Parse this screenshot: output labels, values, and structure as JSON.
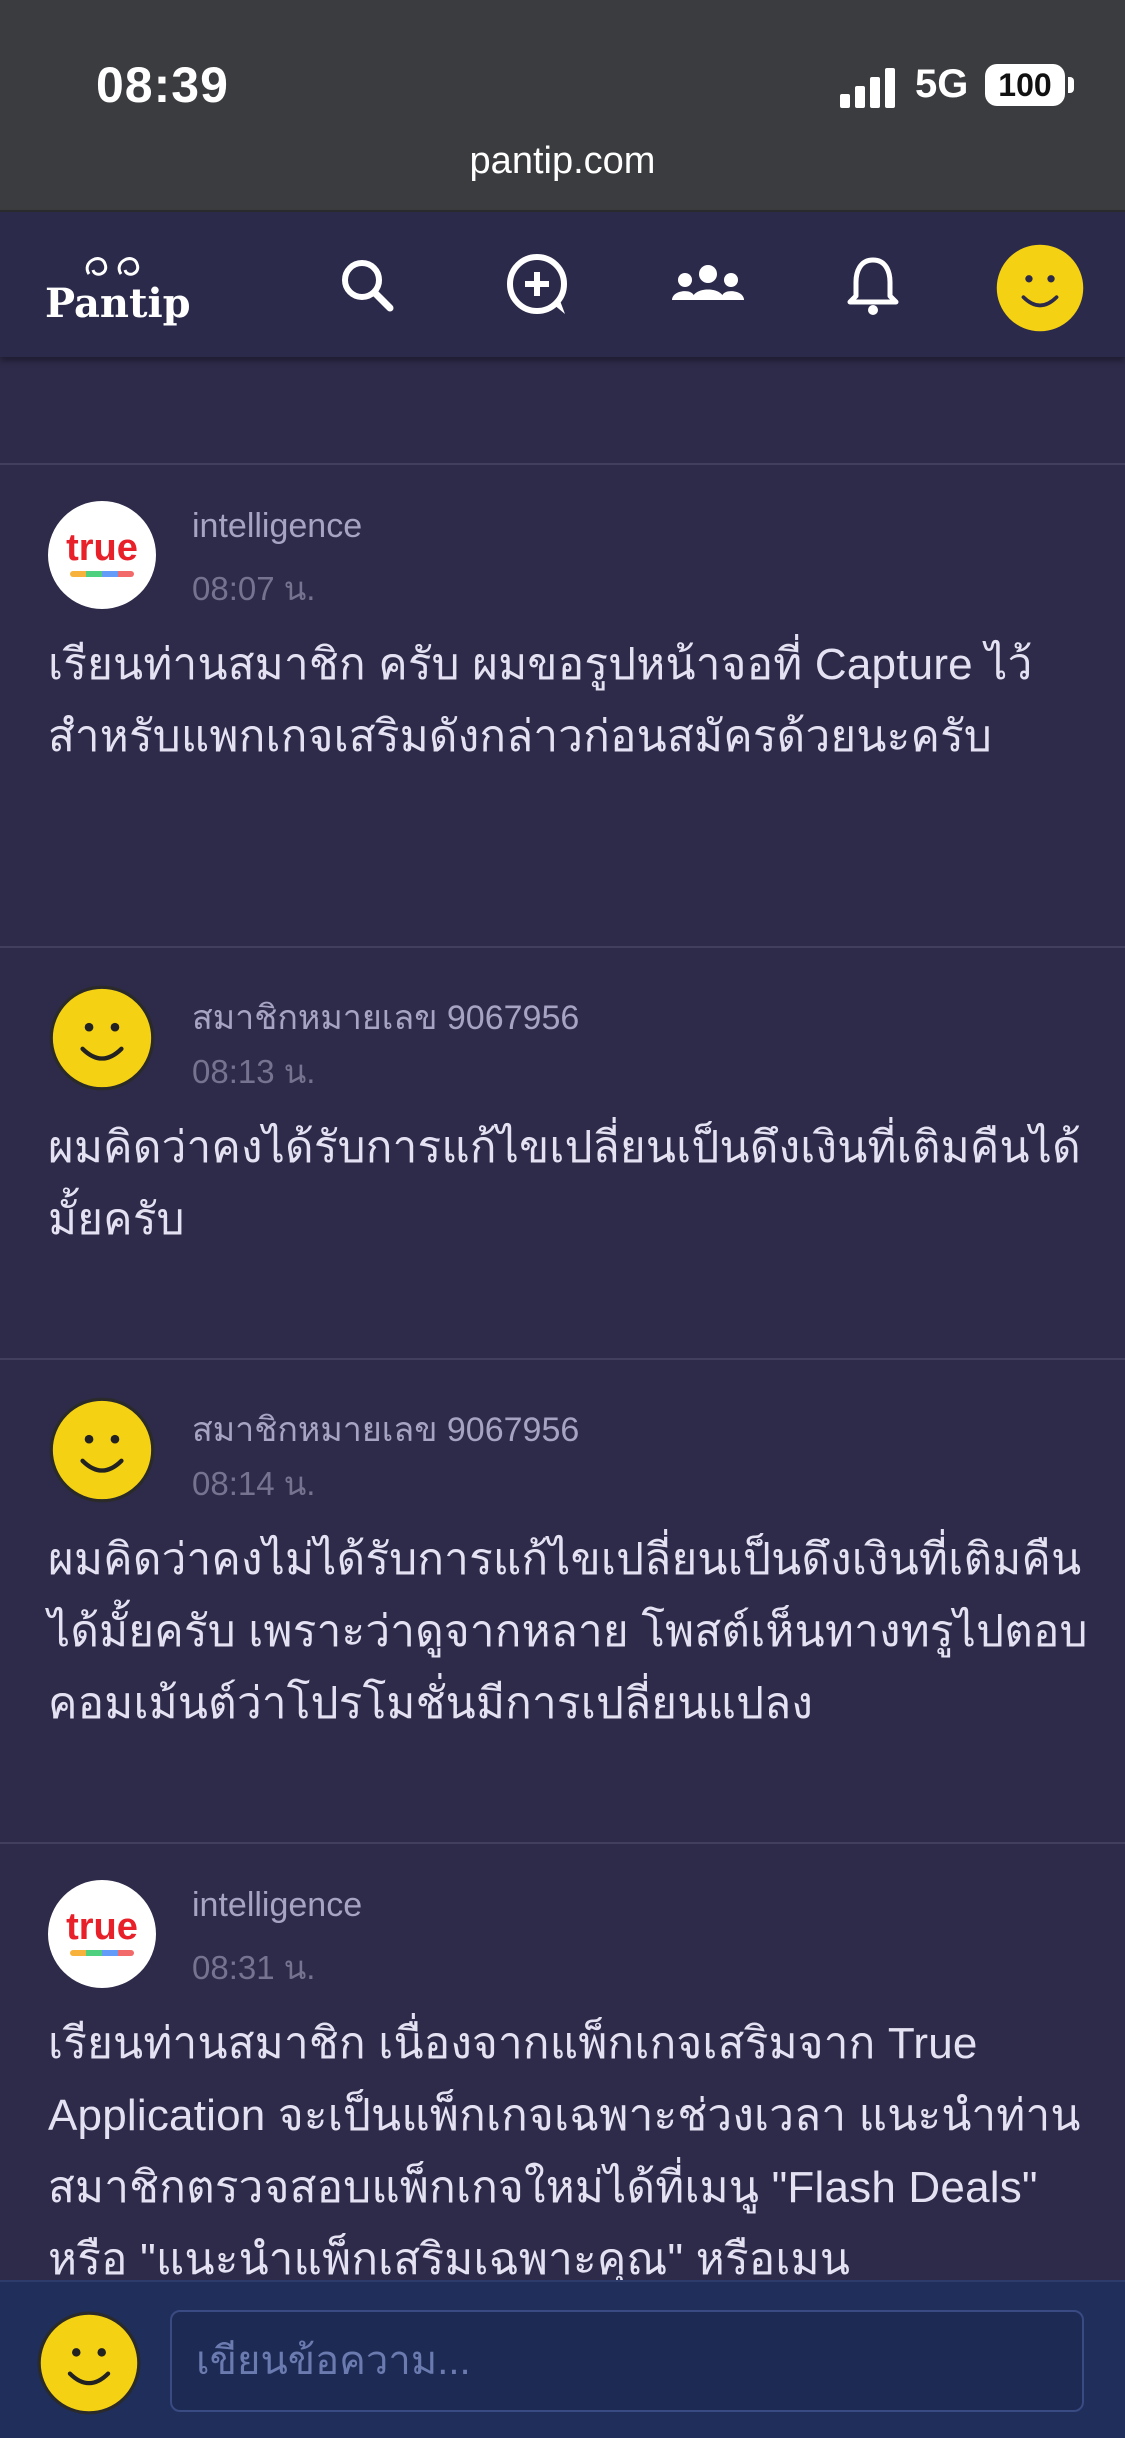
{
  "status": {
    "time": "08:39",
    "network": "5G",
    "battery": "100"
  },
  "browser": {
    "url": "pantip.com"
  },
  "app": {
    "logo_text": "Pantip"
  },
  "posts": [
    {
      "author": "intelligence",
      "time": "08:07 น.",
      "avatar": "true-logo",
      "avatar_text": "true",
      "body": "เรียนท่านสมาชิก  ครับ     ผมขอรูปหน้าจอที่ Capture ไว้สำหรับแพกเกจเสริมดังกล่าวก่อนสมัครด้วยนะครับ"
    },
    {
      "author": "สมาชิกหมายเลข 9067956",
      "time": "08:13 น.",
      "avatar": "smiley-icon",
      "body": "ผมคิดว่าคงได้รับการแก้ไขเปลี่ยนเป็นดึงเงินที่เติมคืนได้มั้ยครับ"
    },
    {
      "author": "สมาชิกหมายเลข 9067956",
      "time": "08:14 น.",
      "avatar": "smiley-icon",
      "body": "ผมคิดว่าคงไม่ได้รับการแก้ไขเปลี่ยนเป็นดึงเงินที่เติมคืนได้มั้ยครับ เพราะว่าดูจากหลาย โพสต์เห็นทางทรูไปตอบคอมเม้นต์ว่าโปรโมชั่นมีการเปลี่ยนแปลง"
    },
    {
      "author": "intelligence",
      "time": "08:31 น.",
      "avatar": "true-logo",
      "avatar_text": "true",
      "body": "เรียนท่านสมาชิก เนื่องจากแพ็กเกจเสริมจาก  True Application จะเป็นแพ็กเกจเฉพาะช่วงเวลา แนะนำท่านสมาชิกตรวจสอบแพ็กเกจใหม่ได้ที่เมนู \"Flash Deals\" หรือ \"แนะนำแพ็กเสริมเฉพาะคุณ\"  หรือเมน"
    }
  ],
  "composer": {
    "placeholder": "เขียนข้อความ..."
  }
}
